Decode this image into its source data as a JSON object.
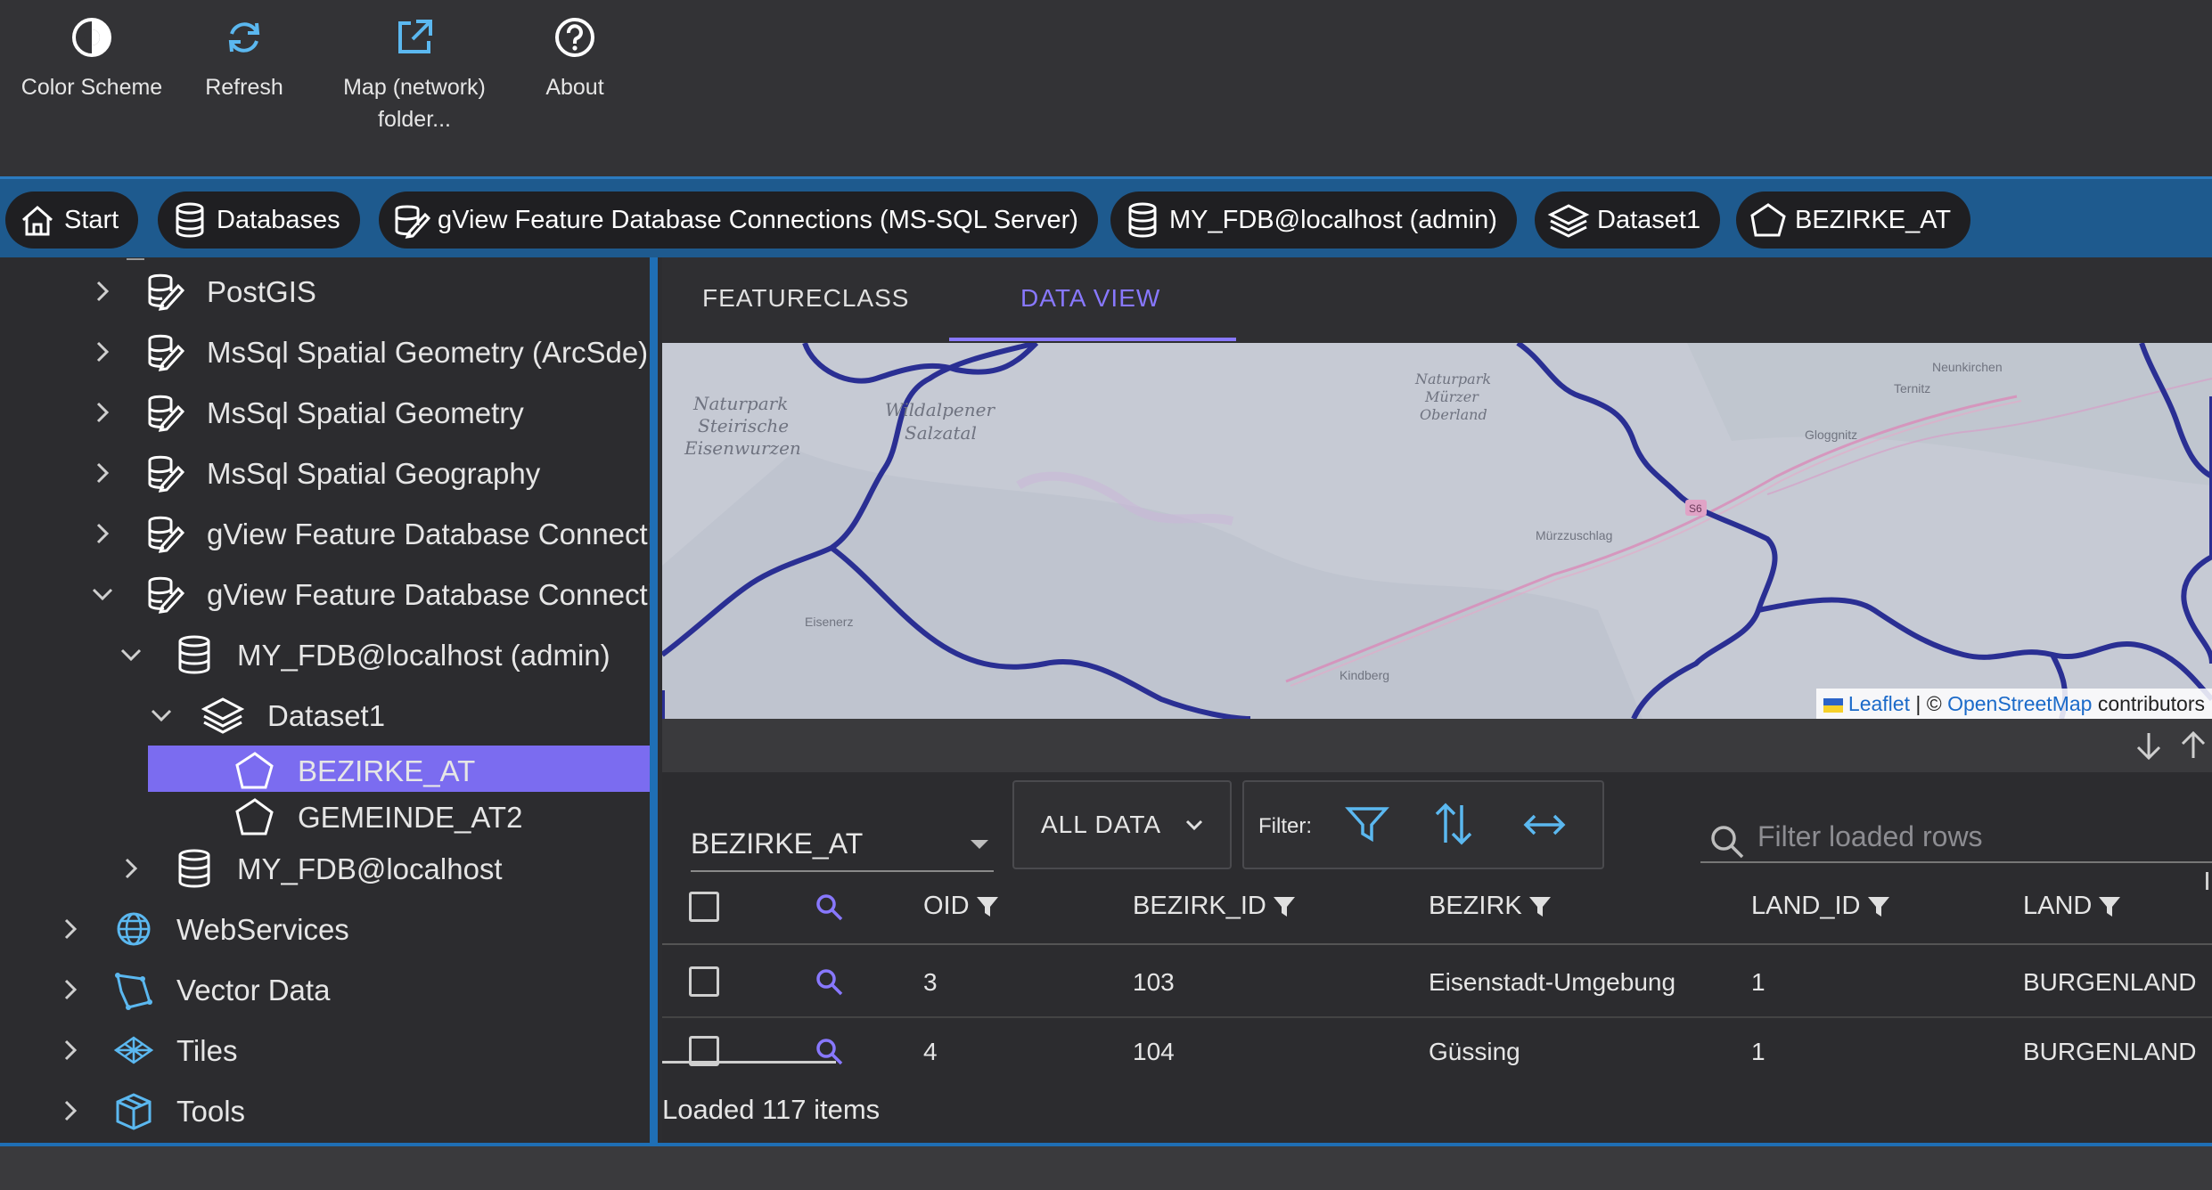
{
  "toolbar": {
    "color_scheme": "Color Scheme",
    "refresh": "Refresh",
    "map_folder_line1": "Map (network)",
    "map_folder_line2": "folder...",
    "about": "About"
  },
  "breadcrumb": {
    "start": "Start",
    "databases": "Databases",
    "connections": "gView Feature Database Connections (MS-SQL Server)",
    "fdb": "MY_FDB@localhost (admin)",
    "dataset": "Dataset1",
    "featureclass": "BEZIRKE_AT"
  },
  "tree": {
    "items": [
      {
        "label": "PostGIS"
      },
      {
        "label": "MsSql Spatial Geometry (ArcSde)"
      },
      {
        "label": "MsSql Spatial Geometry"
      },
      {
        "label": "MsSql Spatial Geography"
      },
      {
        "label": "gView Feature Database Connections"
      },
      {
        "label": "gView Feature Database Connections"
      },
      {
        "label": "MY_FDB@localhost (admin)"
      },
      {
        "label": "Dataset1"
      },
      {
        "label": "BEZIRKE_AT"
      },
      {
        "label": "GEMEINDE_AT2"
      },
      {
        "label": "MY_FDB@localhost"
      },
      {
        "label": "WebServices"
      },
      {
        "label": "Vector Data"
      },
      {
        "label": "Tiles"
      },
      {
        "label": "Tools"
      }
    ]
  },
  "tabs": {
    "featureclass": "FEATURECLASS",
    "dataview": "DATA VIEW"
  },
  "map": {
    "labels": [
      "Naturpark",
      "Steirische",
      "Eisenwurzen",
      "Wildalpener",
      "Salzatal",
      "Naturpark",
      "Mürzer",
      "Oberland",
      "Mürzzuschlag",
      "Gloggnitz",
      "Ternitz",
      "Neunkirchen",
      "Kindberg",
      "Eisenerz",
      "S6"
    ],
    "attribution_leaflet": "Leaflet",
    "attribution_sep": " | © ",
    "attribution_osm": "OpenStreetMap",
    "attribution_tail": " contributors"
  },
  "grid_tools": {
    "layer": "BEZIRKE_AT",
    "scope": "ALL DATA",
    "filter_label": "Filter:",
    "search_placeholder": "Filter loaded rows"
  },
  "table": {
    "columns": [
      "OID",
      "BEZIRK_ID",
      "BEZIRK",
      "LAND_ID",
      "LAND"
    ],
    "rows": [
      {
        "oid": "3",
        "bezirk_id": "103",
        "bezirk": "Eisenstadt-Umgebung",
        "land_id": "1",
        "land": "BURGENLAND"
      },
      {
        "oid": "4",
        "bezirk_id": "104",
        "bezirk": "Güssing",
        "land_id": "1",
        "land": "BURGENLAND"
      }
    ]
  },
  "status": "Loaded 117 items",
  "colors": {
    "accent": "#8878ff",
    "selection": "#7b6cf0",
    "breadcrumb_bar": "#1e5a8e",
    "icon_blue": "#5bb8f0",
    "boundary": "#2a2f93"
  }
}
